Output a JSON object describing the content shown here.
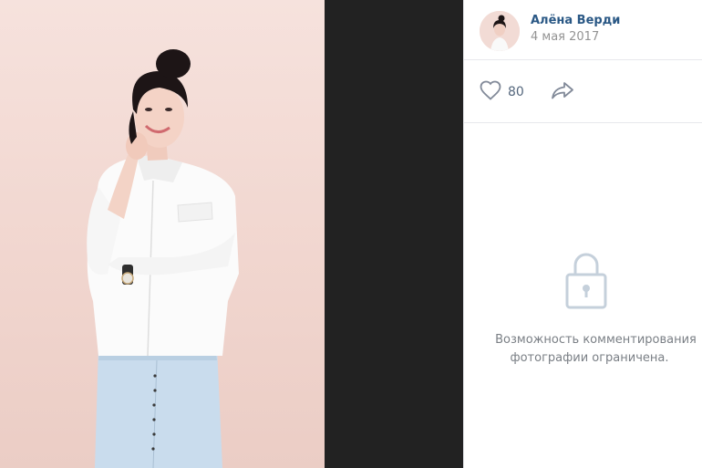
{
  "author": {
    "name": "Алёна Верди",
    "date": "4 мая 2017"
  },
  "actions": {
    "like_count": "80",
    "like_icon": "heart-outline-icon",
    "share_icon": "share-arrow-icon"
  },
  "comments": {
    "lock_icon": "lock-icon",
    "restricted_line1": "Возможность комментирования",
    "restricted_line2": "фотографии ограничена."
  },
  "colors": {
    "viewer_background": "#222222",
    "author_link": "#2a5885",
    "muted_text": "#939393",
    "icon": "#828a99",
    "lock_icon": "#c5d0db",
    "divider": "#e7e8ec"
  }
}
